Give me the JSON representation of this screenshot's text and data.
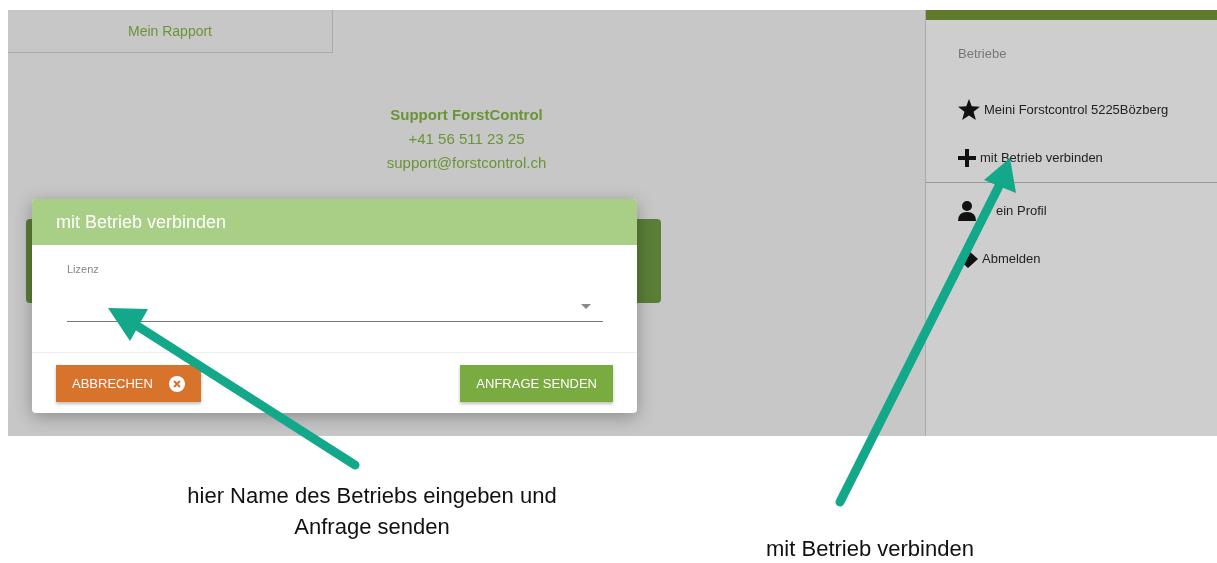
{
  "page": {
    "report_link": "Mein Rapport",
    "support": {
      "title": "Support ForstControl",
      "phone": "+41 56 511 23 25",
      "email": "support@forstcontrol.ch"
    }
  },
  "sidebar": {
    "section_title": "Betriebe",
    "items": [
      {
        "kind": "star",
        "label": "Meini Forstcontrol 5225Bözberg"
      },
      {
        "kind": "plus",
        "label": "mit Betrieb verbinden"
      }
    ],
    "account_items": [
      {
        "kind": "person",
        "label": "ein Profil"
      },
      {
        "kind": "diamond",
        "label": "Abmelden"
      }
    ]
  },
  "dialog": {
    "title": "mit Betrieb verbinden",
    "field": {
      "label": "Lizenz"
    },
    "buttons": [
      {
        "kind": "cancel",
        "label": "ABBRECHEN"
      },
      {
        "kind": "submit",
        "label": "ANFRAGE SENDEN"
      }
    ]
  },
  "annotations": [
    {
      "text": "hier Name des Betriebs eingeben und\nAnfrage senden"
    },
    {
      "text": "mit Betrieb verbinden"
    }
  ]
}
